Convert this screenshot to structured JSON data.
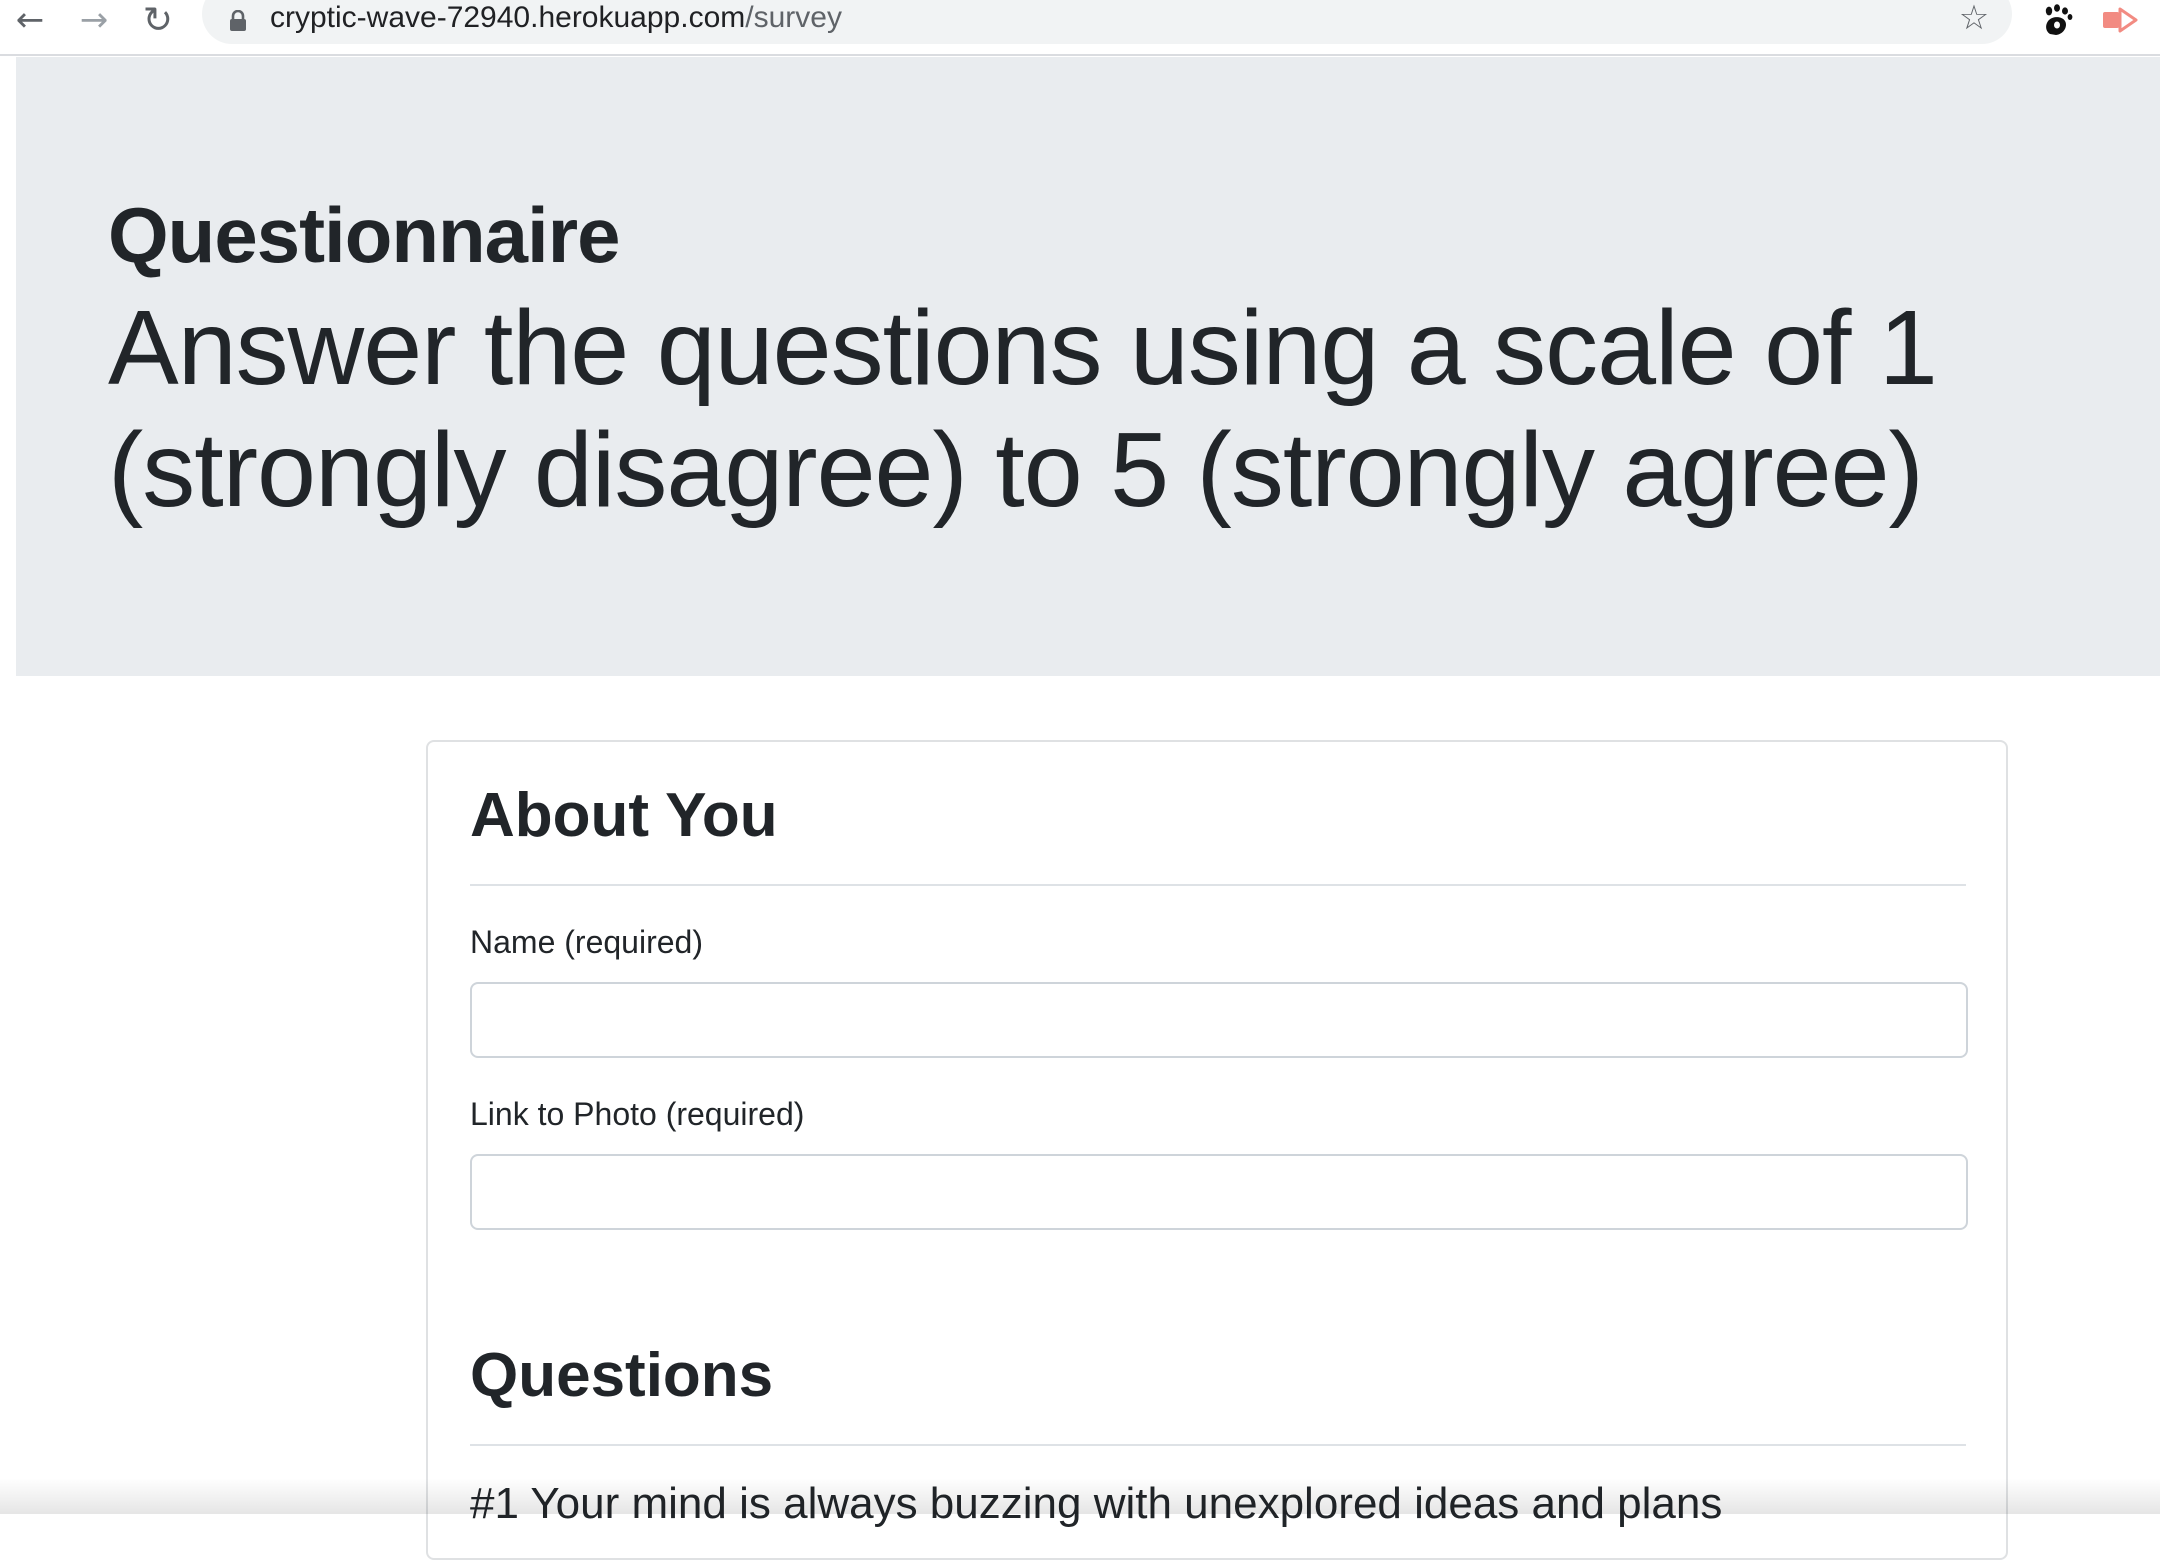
{
  "browser": {
    "back_glyph": "←",
    "forward_glyph": "→",
    "reload_glyph": "↻",
    "url_domain": "cryptic-wave-72940.herokuapp.com",
    "url_path": "/survey",
    "star_glyph": "☆",
    "icons": [
      "back-arrow-icon",
      "forward-arrow-icon",
      "reload-icon",
      "lock-icon",
      "bookmark-star-icon",
      "gnome-extension-icon",
      "cast-extension-icon"
    ]
  },
  "jumbotron": {
    "title": "Questionnaire",
    "lead": "Answer the questions using a scale of 1 (strongly disagree) to 5 (strongly agree)"
  },
  "about": {
    "heading": "About You",
    "name_label": "Name (required)",
    "name_value": "",
    "photo_label": "Link to Photo (required)",
    "photo_value": ""
  },
  "questions": {
    "heading": "Questions",
    "items": [
      {
        "text": "#1  Your mind is always buzzing with unexplored ideas and plans"
      }
    ]
  },
  "colors": {
    "jumbotron_bg": "#e9ecef",
    "text": "#212529",
    "border": "#dee2e6",
    "cast_icon": "#f28b82"
  }
}
